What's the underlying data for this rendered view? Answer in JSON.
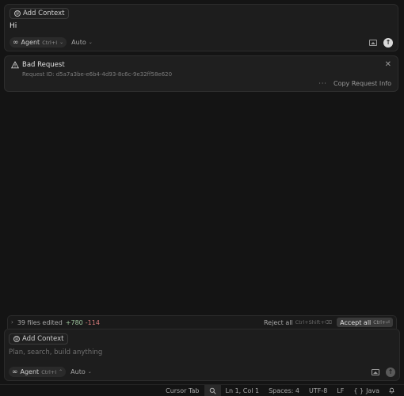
{
  "top_composer": {
    "add_context_label": "Add Context",
    "message": "Hi",
    "agent_label": "Agent",
    "agent_shortcut": "Ctrl+I",
    "model_label": "Auto"
  },
  "error": {
    "title": "Bad Request",
    "request_id": "Request ID: d5a7a3be-e6b4-4d93-8c6c-9e32ff58e620",
    "copy_label": "Copy Request Info",
    "more_glyph": "···",
    "close_glyph": "✕"
  },
  "edits": {
    "summary": "39 files edited",
    "added": "+780",
    "removed": "-114",
    "reject_label": "Reject all",
    "reject_shortcut": "Ctrl+Shift+⌫",
    "accept_label": "Accept all",
    "accept_shortcut": "Ctrl+⏎"
  },
  "bottom_composer": {
    "add_context_label": "Add Context",
    "placeholder": "Plan, search, build anything",
    "agent_label": "Agent",
    "agent_shortcut": "Ctrl+I",
    "model_label": "Auto"
  },
  "status_bar": {
    "cursor_tab": "Cursor Tab",
    "position": "Ln 1, Col 1",
    "spaces": "Spaces: 4",
    "encoding": "UTF-8",
    "eol": "LF",
    "braces": "{ }",
    "language": "Java"
  },
  "colors": {
    "background": "#141414",
    "panel": "#1d1d1d",
    "added": "#9fc79f",
    "removed": "#d77b7b"
  }
}
